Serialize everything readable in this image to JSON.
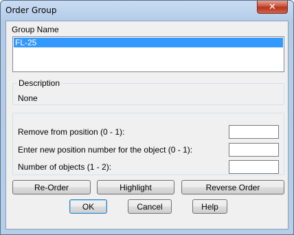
{
  "window": {
    "title": "Order Group",
    "close_glyph": "✕",
    "close_icon": "close-icon"
  },
  "group_name": {
    "label": "Group Name",
    "items": [
      "FL-25"
    ],
    "selected_index": 0
  },
  "description": {
    "label": "Description",
    "value": "None"
  },
  "fields": [
    {
      "label": "Remove from position (0 - 1):",
      "value": ""
    },
    {
      "label": "Enter new position number for the object (0 - 1):",
      "value": ""
    },
    {
      "label": "Number of objects (1 - 2):",
      "value": ""
    }
  ],
  "action_buttons": {
    "reorder": "Re-Order",
    "highlight": "Highlight",
    "reverse": "Reverse Order"
  },
  "dialog_buttons": {
    "ok": "OK",
    "cancel": "Cancel",
    "help": "Help"
  },
  "colors": {
    "selection": "#3399ff",
    "dialog_bg": "#f0f0f0",
    "close_button": "#c8523b"
  }
}
